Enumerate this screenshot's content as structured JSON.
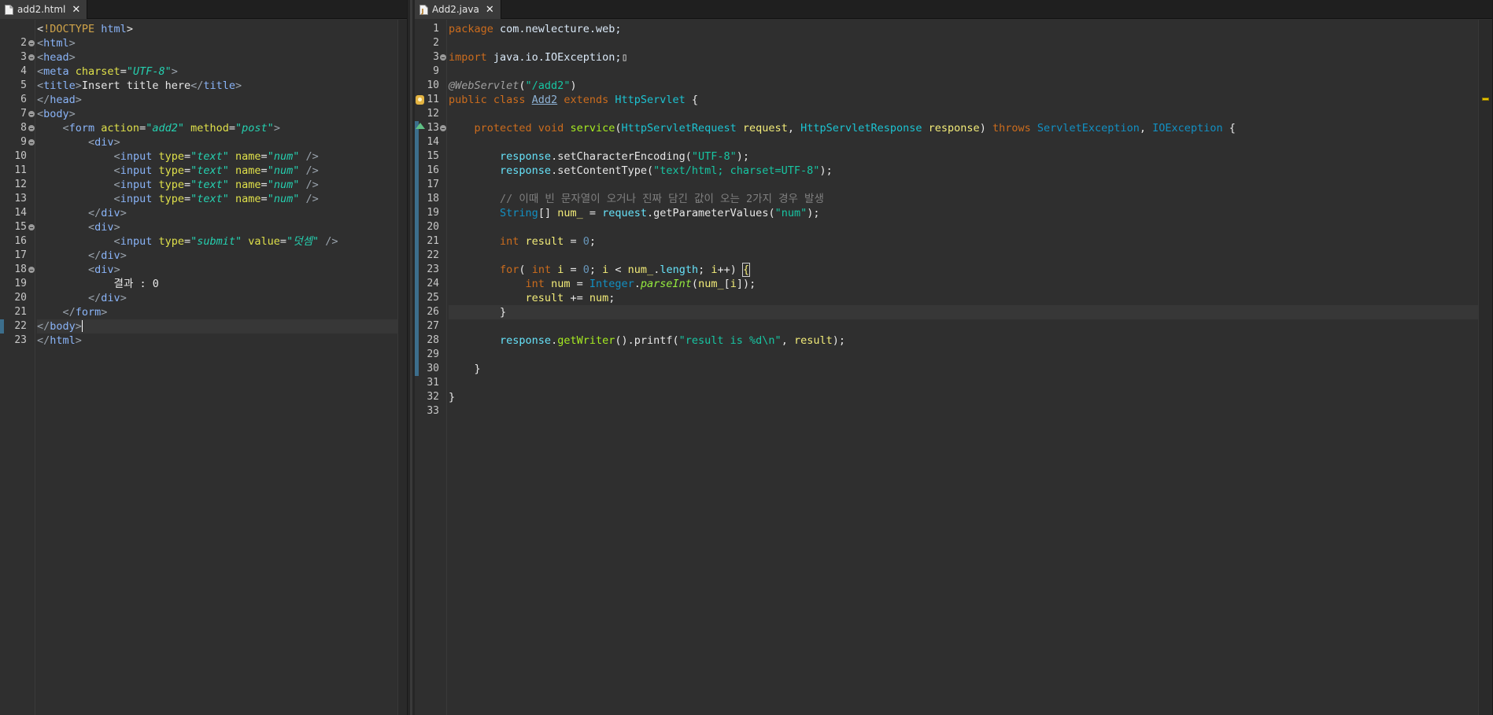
{
  "left_editor": {
    "tab": {
      "title": "add2.html",
      "icon": "html-file-icon",
      "close": "✕"
    },
    "lines": [
      [
        [
          "plain",
          "<"
        ],
        [
          "dt",
          "!DOCTYPE "
        ],
        [
          "tag",
          "html"
        ],
        [
          "plain",
          ">"
        ]
      ],
      [
        [
          "tagb",
          "<"
        ],
        [
          "tag",
          "html"
        ],
        [
          "tagb",
          ">"
        ]
      ],
      [
        [
          "tagb",
          "<"
        ],
        [
          "tag",
          "head"
        ],
        [
          "tagb",
          ">"
        ]
      ],
      [
        [
          "tagb",
          "<"
        ],
        [
          "tag",
          "meta "
        ],
        [
          "attr",
          "charset"
        ],
        [
          "plain",
          "="
        ],
        [
          "aval",
          "\"UTF-8\""
        ],
        [
          "tagb",
          ">"
        ]
      ],
      [
        [
          "tagb",
          "<"
        ],
        [
          "tag",
          "title"
        ],
        [
          "tagb",
          ">"
        ],
        [
          "plain",
          "Insert title here"
        ],
        [
          "tagb",
          "</"
        ],
        [
          "tag",
          "title"
        ],
        [
          "tagb",
          ">"
        ]
      ],
      [
        [
          "tagb",
          "</"
        ],
        [
          "tag",
          "head"
        ],
        [
          "tagb",
          ">"
        ]
      ],
      [
        [
          "tagb",
          "<"
        ],
        [
          "tag",
          "body"
        ],
        [
          "tagb",
          ">"
        ]
      ],
      [
        [
          "plain",
          "    "
        ],
        [
          "tagb",
          "<"
        ],
        [
          "tag",
          "form "
        ],
        [
          "attr",
          "action"
        ],
        [
          "plain",
          "="
        ],
        [
          "aval",
          "\"add2\" "
        ],
        [
          "attr",
          "method"
        ],
        [
          "plain",
          "="
        ],
        [
          "aval",
          "\"post\""
        ],
        [
          "tagb",
          ">"
        ]
      ],
      [
        [
          "plain",
          "        "
        ],
        [
          "tagb",
          "<"
        ],
        [
          "tag",
          "div"
        ],
        [
          "tagb",
          ">"
        ]
      ],
      [
        [
          "plain",
          "            "
        ],
        [
          "tagb",
          "<"
        ],
        [
          "tag",
          "input "
        ],
        [
          "attr",
          "type"
        ],
        [
          "plain",
          "="
        ],
        [
          "aval",
          "\"text\" "
        ],
        [
          "attr",
          "name"
        ],
        [
          "plain",
          "="
        ],
        [
          "aval",
          "\"num\" "
        ],
        [
          "tagb",
          "/>"
        ]
      ],
      [
        [
          "plain",
          "            "
        ],
        [
          "tagb",
          "<"
        ],
        [
          "tag",
          "input "
        ],
        [
          "attr",
          "type"
        ],
        [
          "plain",
          "="
        ],
        [
          "aval",
          "\"text\" "
        ],
        [
          "attr",
          "name"
        ],
        [
          "plain",
          "="
        ],
        [
          "aval",
          "\"num\" "
        ],
        [
          "tagb",
          "/>"
        ]
      ],
      [
        [
          "plain",
          "            "
        ],
        [
          "tagb",
          "<"
        ],
        [
          "tag",
          "input "
        ],
        [
          "attr",
          "type"
        ],
        [
          "plain",
          "="
        ],
        [
          "aval",
          "\"text\" "
        ],
        [
          "attr",
          "name"
        ],
        [
          "plain",
          "="
        ],
        [
          "aval",
          "\"num\" "
        ],
        [
          "tagb",
          "/>"
        ]
      ],
      [
        [
          "plain",
          "            "
        ],
        [
          "tagb",
          "<"
        ],
        [
          "tag",
          "input "
        ],
        [
          "attr",
          "type"
        ],
        [
          "plain",
          "="
        ],
        [
          "aval",
          "\"text\" "
        ],
        [
          "attr",
          "name"
        ],
        [
          "plain",
          "="
        ],
        [
          "aval",
          "\"num\" "
        ],
        [
          "tagb",
          "/>"
        ]
      ],
      [
        [
          "plain",
          "        "
        ],
        [
          "tagb",
          "</"
        ],
        [
          "tag",
          "div"
        ],
        [
          "tagb",
          ">"
        ]
      ],
      [
        [
          "plain",
          "        "
        ],
        [
          "tagb",
          "<"
        ],
        [
          "tag",
          "div"
        ],
        [
          "tagb",
          ">"
        ]
      ],
      [
        [
          "plain",
          "            "
        ],
        [
          "tagb",
          "<"
        ],
        [
          "tag",
          "input "
        ],
        [
          "attr",
          "type"
        ],
        [
          "plain",
          "="
        ],
        [
          "aval",
          "\"submit\" "
        ],
        [
          "attr",
          "value"
        ],
        [
          "plain",
          "="
        ],
        [
          "aval",
          "\"덧셈\" "
        ],
        [
          "tagb",
          "/>"
        ]
      ],
      [
        [
          "plain",
          "        "
        ],
        [
          "tagb",
          "</"
        ],
        [
          "tag",
          "div"
        ],
        [
          "tagb",
          ">"
        ]
      ],
      [
        [
          "plain",
          "        "
        ],
        [
          "tagb",
          "<"
        ],
        [
          "tag",
          "div"
        ],
        [
          "tagb",
          ">"
        ]
      ],
      [
        [
          "plain",
          "            결과 : 0"
        ]
      ],
      [
        [
          "plain",
          "        "
        ],
        [
          "tagb",
          "</"
        ],
        [
          "tag",
          "div"
        ],
        [
          "tagb",
          ">"
        ]
      ],
      [
        [
          "plain",
          "    "
        ],
        [
          "tagb",
          "</"
        ],
        [
          "tag",
          "form"
        ],
        [
          "tagb",
          ">"
        ]
      ],
      [
        [
          "tagb",
          "</"
        ],
        [
          "tag",
          "body"
        ],
        [
          "tagb",
          ">"
        ]
      ],
      [
        [
          "tagb",
          "</"
        ],
        [
          "tag",
          "html"
        ],
        [
          "tagb",
          ">"
        ]
      ]
    ],
    "line_numbers": [
      "2",
      "3",
      "4",
      "5",
      "6",
      "7",
      "8",
      "9",
      "10",
      "11",
      "12",
      "13",
      "14",
      "15",
      "16",
      "17",
      "18",
      "19",
      "20",
      "21",
      "22",
      "23"
    ]
  },
  "right_editor": {
    "tab": {
      "title": "Add2.java",
      "icon": "java-file-icon",
      "close": "✕"
    },
    "lines": [
      [
        "1",
        [
          [
            "kw",
            "package "
          ],
          [
            "pkg",
            "com.newlecture.web;"
          ]
        ]
      ],
      [
        "2",
        []
      ],
      [
        "3",
        [
          [
            "kw",
            "import "
          ],
          [
            "pkg",
            "java.io.IOException;"
          ],
          [
            "plain",
            "▯"
          ]
        ]
      ],
      [
        "9",
        []
      ],
      [
        "10",
        [
          [
            "ann",
            "@WebServlet"
          ],
          [
            "plain",
            "("
          ],
          [
            "str",
            "\"/add2\""
          ],
          [
            "plain",
            ")"
          ]
        ]
      ],
      [
        "11",
        [
          [
            "kw",
            "public class "
          ],
          [
            "ovr",
            "Add2"
          ],
          [
            "kw",
            " extends "
          ],
          [
            "cls",
            "HttpServlet"
          ],
          [
            "plain",
            " {"
          ]
        ]
      ],
      [
        "12",
        []
      ],
      [
        "13",
        [
          [
            "plain",
            "    "
          ],
          [
            "kw",
            "protected void "
          ],
          [
            "mth",
            "service"
          ],
          [
            "plain",
            "("
          ],
          [
            "cls",
            "HttpServletRequest "
          ],
          [
            "var",
            "request"
          ],
          [
            "plain",
            ", "
          ],
          [
            "cls",
            "HttpServletResponse "
          ],
          [
            "var",
            "response"
          ],
          [
            "plain",
            ") "
          ],
          [
            "kw",
            "throws "
          ],
          [
            "typ",
            "ServletException"
          ],
          [
            "plain",
            ", "
          ],
          [
            "typ",
            "IOException"
          ],
          [
            "plain",
            " {"
          ]
        ]
      ],
      [
        "14",
        []
      ],
      [
        "15",
        [
          [
            "plain",
            "        "
          ],
          [
            "fld",
            "response"
          ],
          [
            "plain",
            ".setCharacterEncoding("
          ],
          [
            "str",
            "\"UTF-8\""
          ],
          [
            "plain",
            ");"
          ]
        ]
      ],
      [
        "16",
        [
          [
            "plain",
            "        "
          ],
          [
            "fld",
            "response"
          ],
          [
            "plain",
            ".setContentType("
          ],
          [
            "str",
            "\"text/html; charset=UTF-8\""
          ],
          [
            "plain",
            ");"
          ]
        ]
      ],
      [
        "17",
        []
      ],
      [
        "18",
        [
          [
            "plain",
            "        "
          ],
          [
            "cmt",
            "// 이때 빈 문자열이 오거나 진짜 담긴 값이 오는 2가지 경우 발생"
          ]
        ]
      ],
      [
        "19",
        [
          [
            "plain",
            "        "
          ],
          [
            "typ",
            "String"
          ],
          [
            "plain",
            "[] "
          ],
          [
            "var",
            "num_"
          ],
          [
            "plain",
            " = "
          ],
          [
            "fld",
            "request"
          ],
          [
            "plain",
            ".getParameterValues("
          ],
          [
            "str",
            "\"num\""
          ],
          [
            "plain",
            ");"
          ]
        ]
      ],
      [
        "20",
        []
      ],
      [
        "21",
        [
          [
            "plain",
            "        "
          ],
          [
            "kw",
            "int "
          ],
          [
            "var",
            "result"
          ],
          [
            "plain",
            " = "
          ],
          [
            "num",
            "0"
          ],
          [
            "plain",
            ";"
          ]
        ]
      ],
      [
        "22",
        []
      ],
      [
        "23",
        [
          [
            "plain",
            "        "
          ],
          [
            "kw",
            "for"
          ],
          [
            "plain",
            "( "
          ],
          [
            "kw",
            "int "
          ],
          [
            "var",
            "i"
          ],
          [
            "plain",
            " = "
          ],
          [
            "num",
            "0"
          ],
          [
            "plain",
            "; "
          ],
          [
            "var",
            "i"
          ],
          [
            "plain",
            " < "
          ],
          [
            "var",
            "num_"
          ],
          [
            "plain",
            "."
          ],
          [
            "fld",
            "length"
          ],
          [
            "plain",
            "; "
          ],
          [
            "var",
            "i"
          ],
          [
            "plain",
            "++) "
          ],
          [
            "box",
            "{"
          ]
        ]
      ],
      [
        "24",
        [
          [
            "plain",
            "            "
          ],
          [
            "kw",
            "int "
          ],
          [
            "var",
            "num"
          ],
          [
            "plain",
            " = "
          ],
          [
            "typ",
            "Integer"
          ],
          [
            "plain",
            "."
          ],
          [
            "smth",
            "parseInt"
          ],
          [
            "plain",
            "("
          ],
          [
            "var",
            "num_"
          ],
          [
            "plain",
            "["
          ],
          [
            "var",
            "i"
          ],
          [
            "plain",
            "]);"
          ]
        ]
      ],
      [
        "25",
        [
          [
            "plain",
            "            "
          ],
          [
            "var",
            "result"
          ],
          [
            "plain",
            " += "
          ],
          [
            "var",
            "num"
          ],
          [
            "plain",
            ";"
          ]
        ]
      ],
      [
        "26",
        [
          [
            "plain",
            "        }"
          ]
        ]
      ],
      [
        "27",
        []
      ],
      [
        "28",
        [
          [
            "plain",
            "        "
          ],
          [
            "fld",
            "response"
          ],
          [
            "plain",
            "."
          ],
          [
            "mth",
            "getWriter"
          ],
          [
            "plain",
            "().printf("
          ],
          [
            "str",
            "\"result is %d\\n\""
          ],
          [
            "plain",
            ", "
          ],
          [
            "var",
            "result"
          ],
          [
            "plain",
            ");"
          ]
        ]
      ],
      [
        "29",
        []
      ],
      [
        "30",
        [
          [
            "plain",
            "    }"
          ]
        ]
      ],
      [
        "31",
        []
      ],
      [
        "32",
        [
          [
            "plain",
            "}"
          ]
        ]
      ],
      [
        "33",
        []
      ]
    ]
  },
  "colors": {
    "background": "#2f2f2f",
    "keyword": "#cc6c1d",
    "string": "#17c6a3",
    "comment": "#808080",
    "type": "#1290c3",
    "current_line": "#373737"
  }
}
